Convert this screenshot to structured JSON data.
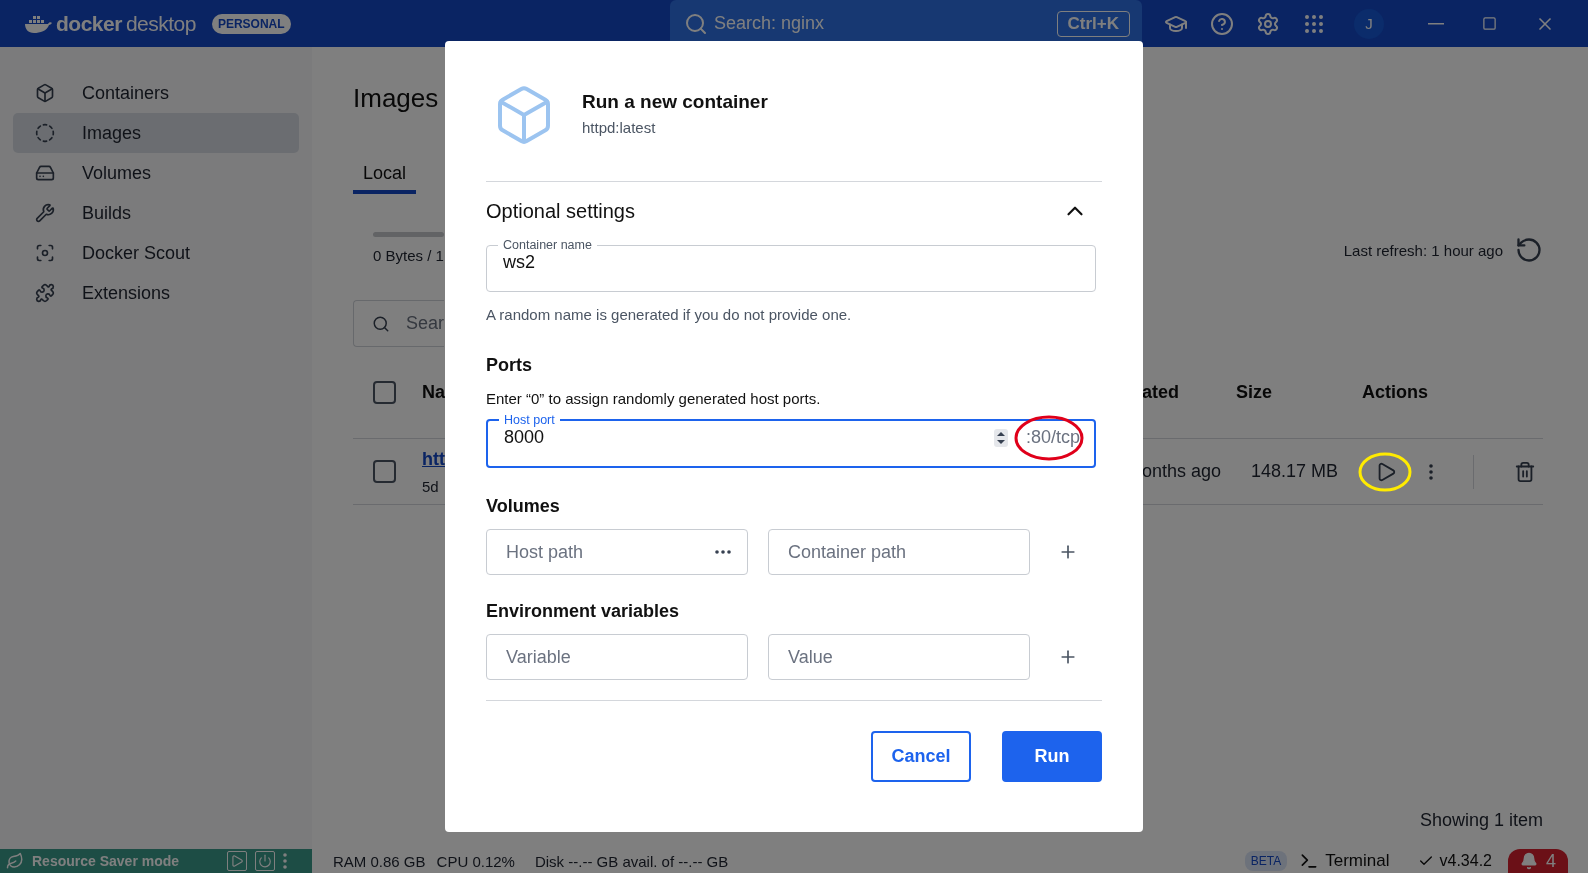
{
  "title_bar": {
    "brand": "docker",
    "product": "desktop",
    "plan_badge": "PERSONAL",
    "search_label": "Search: nginx",
    "shortcut": "Ctrl+K",
    "avatar": "J"
  },
  "sidebar": {
    "items": [
      {
        "label": "Containers",
        "kind": "containers",
        "selected": false
      },
      {
        "label": "Images",
        "kind": "images",
        "selected": true
      },
      {
        "label": "Volumes",
        "kind": "volumes",
        "selected": false
      },
      {
        "label": "Builds",
        "kind": "builds",
        "selected": false
      },
      {
        "label": "Docker Scout",
        "kind": "scout",
        "selected": false
      },
      {
        "label": "Extensions",
        "kind": "extensions",
        "selected": false
      }
    ]
  },
  "page": {
    "title": "Images",
    "tabs": [
      {
        "label": "Local",
        "selected": true
      }
    ],
    "storage_text": "0 Bytes / 1",
    "last_refresh": "Last refresh: 1 hour ago",
    "search": {
      "placeholder": "Sear"
    },
    "table": {
      "columns": [
        "Na",
        "ated",
        "Size",
        "Actions"
      ],
      "select_all_checked": false,
      "rows": [
        {
          "name": "htt",
          "id": "5d",
          "created": "onths ago",
          "size": "148.17 MB",
          "checked": false
        }
      ]
    },
    "footer": "Showing 1 item"
  },
  "status_bar": {
    "resource_saver": "Resource Saver mode",
    "ram": "RAM 0.86 GB",
    "cpu": "CPU 0.12%",
    "disk": "Disk --.-- GB avail. of --.-- GB",
    "beta": "BETA",
    "terminal": "Terminal",
    "version": "v4.34.2",
    "notifications": "4"
  },
  "dialog": {
    "title": "Run a new container",
    "subtitle": "httpd:latest",
    "section": "Optional settings",
    "expanded": true,
    "container_name": {
      "label": "Container name",
      "value": "ws2",
      "hint": "A random name is generated if you do not provide one."
    },
    "ports": {
      "heading": "Ports",
      "hint": "Enter “0” to assign randomly generated host ports.",
      "label": "Host port",
      "value": "8000",
      "suffix": ":80/tcp",
      "focused": true
    },
    "volumes": {
      "heading": "Volumes",
      "placeholders": [
        "Host path",
        "Container path"
      ]
    },
    "environment": {
      "heading": "Environment variables",
      "placeholders": [
        "Variable",
        "Value"
      ]
    },
    "buttons": [
      {
        "label": "Cancel",
        "kind": "secondary"
      },
      {
        "label": "Run",
        "kind": "primary"
      }
    ]
  },
  "annotations": [
    {
      "color": "#ffeb00"
    },
    {
      "color": "#e0001a"
    }
  ]
}
